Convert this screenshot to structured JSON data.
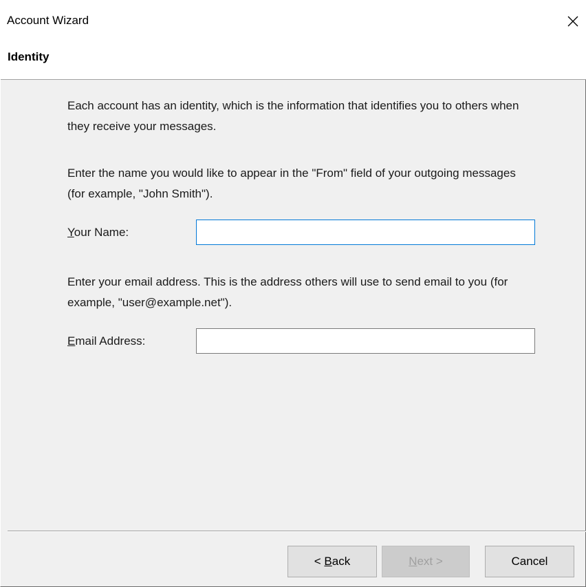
{
  "window": {
    "title": "Account Wizard",
    "close_glyph": "close-icon"
  },
  "page": {
    "title": "Identity"
  },
  "content": {
    "intro": "Each account has an identity, which is the information that identifies you to others when they receive your messages.",
    "name_instructions": "Enter the name you would like to appear in the \"From\" field of your outgoing messages (for example, \"John Smith\").",
    "name_label_accel": "Y",
    "name_label_rest": "our Name:",
    "name_value": "",
    "email_instructions": "Enter your email address. This is the address others will use to send email to you (for example, \"user@example.net\").",
    "email_label_accel": "E",
    "email_label_rest": "mail Address:",
    "email_value": ""
  },
  "buttons": {
    "back_prefix": "< ",
    "back_accel": "B",
    "back_rest": "ack",
    "next_accel": "N",
    "next_rest": "ext >",
    "cancel": "Cancel"
  },
  "colors": {
    "focus_border": "#0078d7",
    "dialog_background": "#f0f0f0"
  }
}
